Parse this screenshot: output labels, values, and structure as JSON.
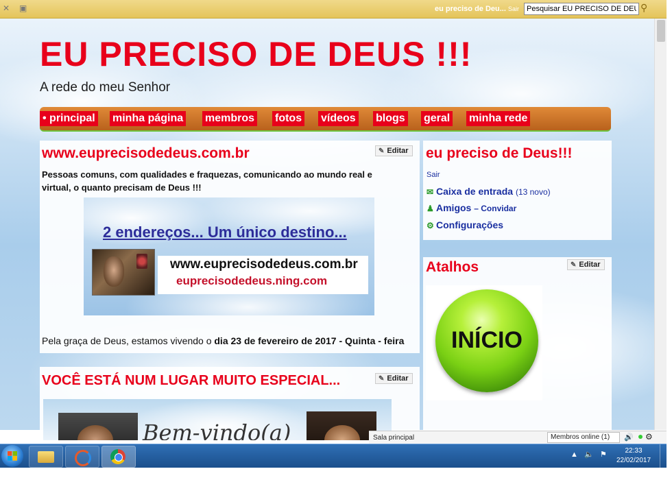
{
  "topbar": {
    "site_name": "eu preciso de Deu...",
    "sair": "Sair",
    "search_value": "Pesquisar EU PRECISO DE DEUS !!!"
  },
  "header": {
    "title": "EU PRECISO DE DEUS !!!",
    "subtitle": "A rede do meu Senhor"
  },
  "nav": {
    "items": [
      "• principal",
      "minha página",
      "membros",
      "fotos",
      "vídeos",
      "blogs",
      "geral",
      "minha rede"
    ]
  },
  "main": {
    "section_title": "www.eupreciso dedeus.com.br",
    "edit_label": "Editar",
    "intro": "Pessoas comuns, com qualidades e fraquezas, comunicando ao mundo real e virtual, o quanto precisam de Deus !!!",
    "banner": {
      "headline": "2 endereços... Um único destino...",
      "url1": "www.euprecisodedeus.com.br",
      "url2": "euprecisodedeus.ning.com"
    },
    "date_prefix": "Pela graça de Deus, estamos vivendo o ",
    "date_bold": "dia 23 de fevereiro de 2017 - Quinta - feira"
  },
  "special": {
    "section_title": "VOCÊ ESTÁ NUM LUGAR MUITO ESPECIAL...",
    "edit_label": "Editar",
    "script_text": "Bem-vindo(a)"
  },
  "sidebar": {
    "profile_title": "eu preciso de Deus!!!",
    "sair": "Sair",
    "inbox_label": "Caixa de entrada",
    "inbox_count": "(13 novo)",
    "friends_label": "Amigos",
    "invite_label": "– Convidar",
    "settings_label": "Configurações",
    "shortcuts_title": "Atalhos",
    "edit_label": "Editar",
    "inicio_label": "INÍCIO"
  },
  "chat": {
    "room": "Sala principal",
    "members_online": "Membros online (1)"
  },
  "taskbar": {
    "time": "22:33",
    "date": "22/02/2017"
  }
}
